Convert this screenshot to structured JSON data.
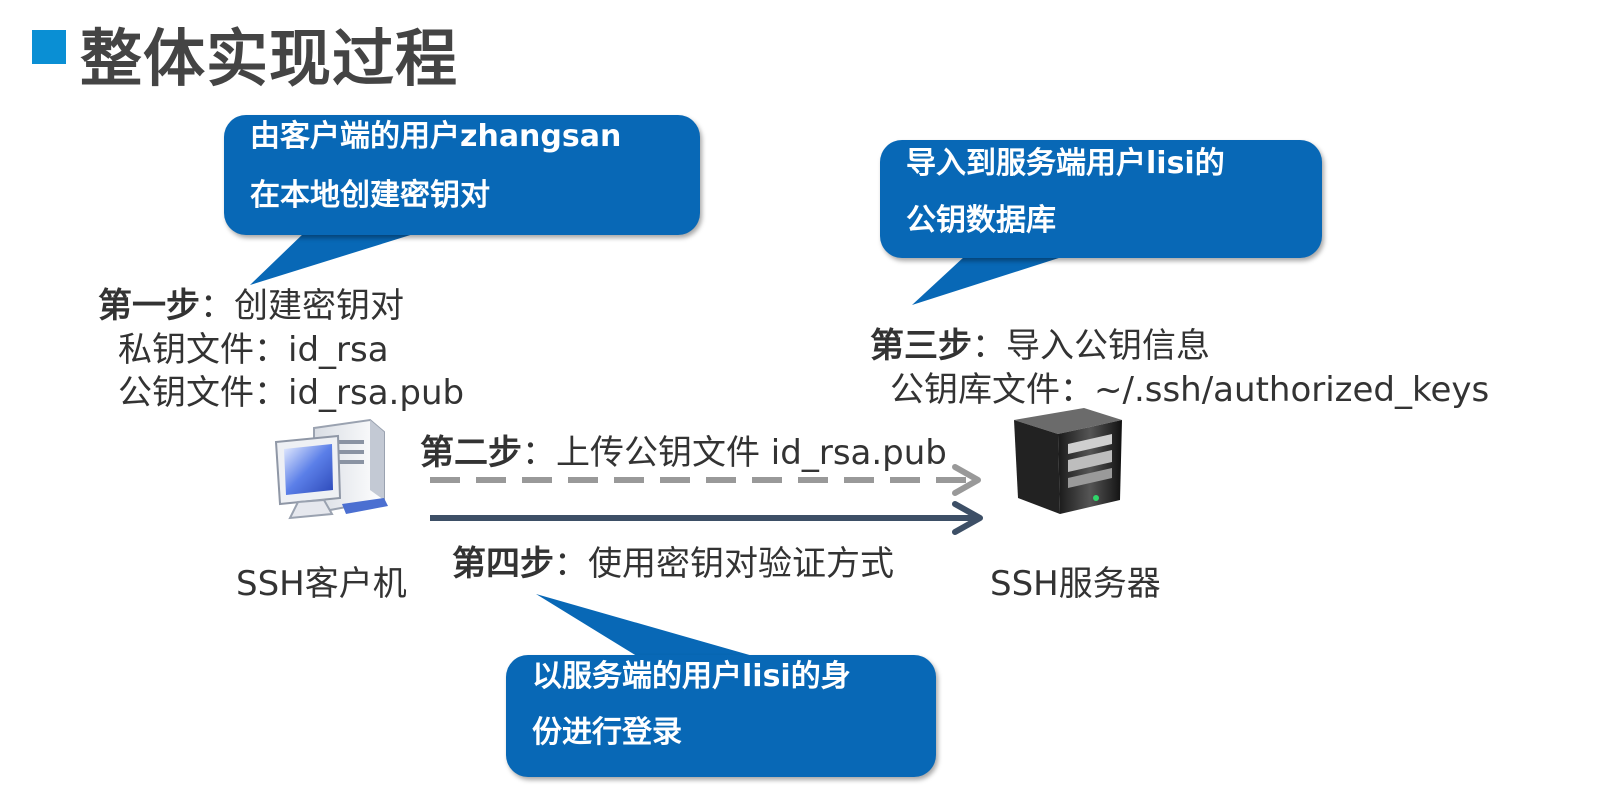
{
  "title": "整体实现过程",
  "callouts": {
    "create_keys": {
      "line1": "由客户端的用户zhangsan",
      "line2": "在本地创建密钥对"
    },
    "import_key": {
      "line1": "导入到服务端用户lisi的",
      "line2": "公钥数据库"
    },
    "login": {
      "line1": "以服务端的用户lisi的身",
      "line2": "份进行登录"
    }
  },
  "steps": {
    "step1": {
      "label": "第一步",
      "text": "：创建密钥对",
      "private_key": "私钥文件：id_rsa",
      "public_key": "公钥文件：id_rsa.pub"
    },
    "step2": {
      "label": "第二步",
      "text": "：上传公钥文件 id_rsa.pub"
    },
    "step3": {
      "label": "第三步",
      "text": "：导入公钥信息",
      "key_file": "公钥库文件：~/.ssh/authorized_keys"
    },
    "step4": {
      "label": "第四步",
      "text": "：使用密钥对验证方式"
    }
  },
  "devices": {
    "client": {
      "label": "SSH客户机",
      "icon": "computer-icon"
    },
    "server": {
      "label": "SSH服务器",
      "icon": "server-icon"
    }
  },
  "colors": {
    "callout": "#0868b6",
    "marker": "#0a8fd4",
    "upload_arrow": "#999999",
    "auth_arrow": "#3d4f66"
  }
}
